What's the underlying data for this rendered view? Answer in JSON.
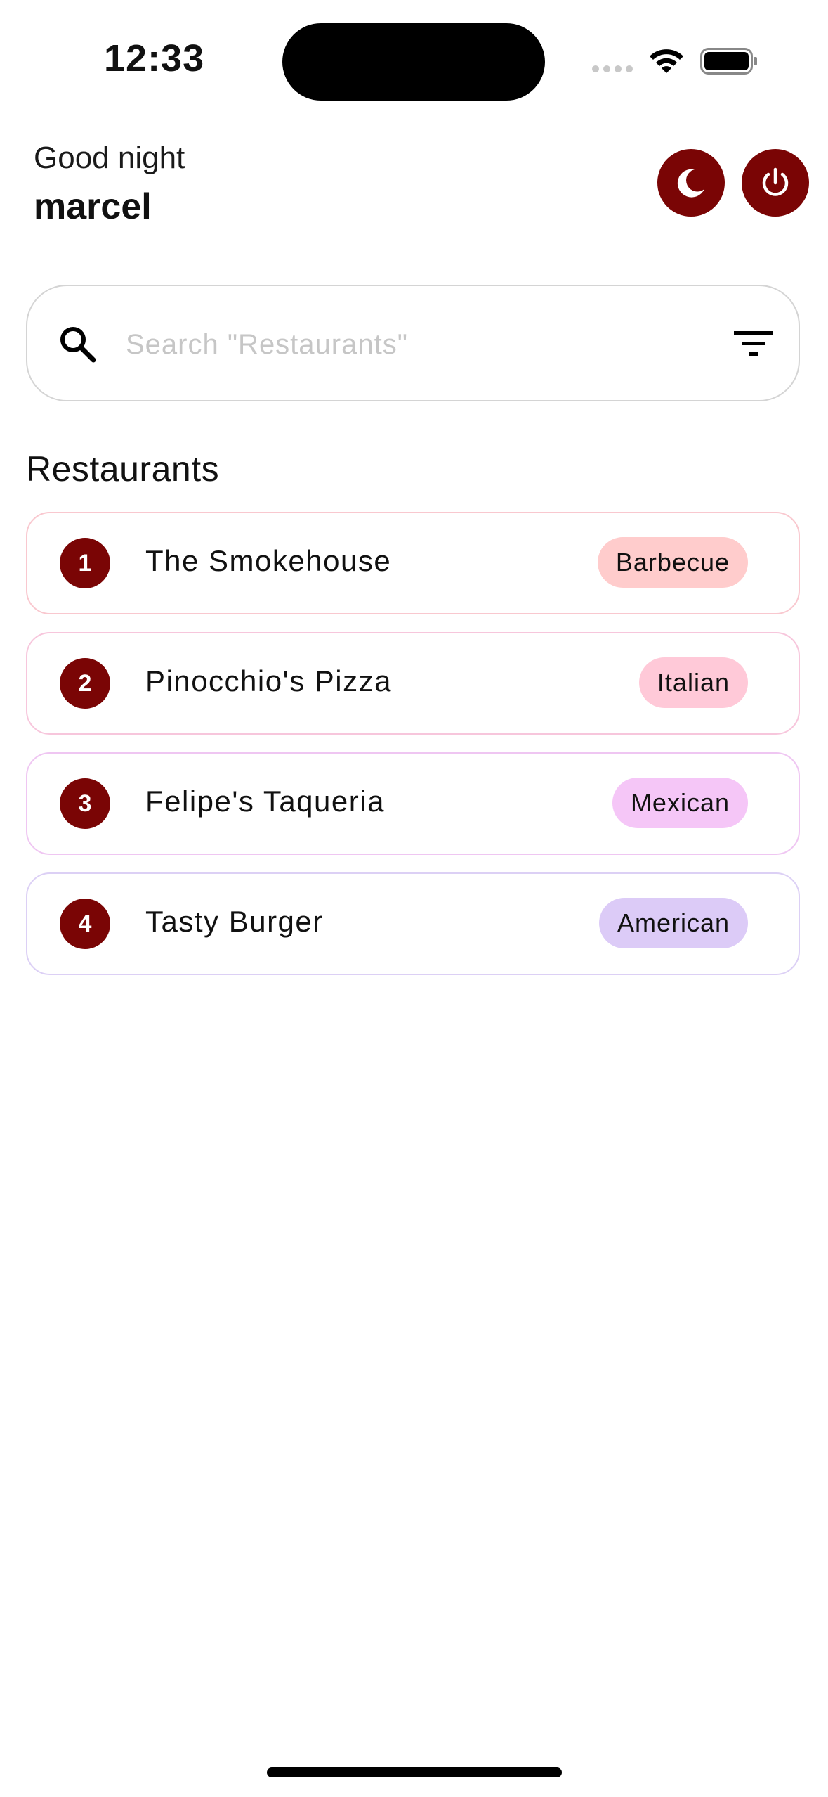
{
  "status_bar": {
    "time": "12:33"
  },
  "header": {
    "greeting": "Good night",
    "username": "marcel",
    "theme_button_icon": "moon-icon",
    "logout_button_icon": "power-icon"
  },
  "search": {
    "placeholder": "Search \"Restaurants\"",
    "value": "",
    "icon": "search-icon",
    "filter_icon": "filter-icon"
  },
  "section": {
    "title": "Restaurants"
  },
  "restaurants": [
    {
      "rank": "1",
      "name": "The Smokehouse",
      "cuisine": "Barbecue",
      "tag_color": "#ffcccc",
      "border_color": "#f9c8cf"
    },
    {
      "rank": "2",
      "name": "Pinocchio's Pizza",
      "cuisine": "Italian",
      "tag_color": "#ffc9d8",
      "border_color": "#f7c6dc"
    },
    {
      "rank": "3",
      "name": "Felipe's Taqueria",
      "cuisine": "Mexican",
      "tag_color": "#f5c6f7",
      "border_color": "#efc6f2"
    },
    {
      "rank": "4",
      "name": "Tasty Burger",
      "cuisine": "American",
      "tag_color": "#dccbf7",
      "border_color": "#dcd0f5"
    }
  ],
  "colors": {
    "accent": "#7a0505",
    "text": "#111111",
    "placeholder": "#c6c6c6"
  }
}
